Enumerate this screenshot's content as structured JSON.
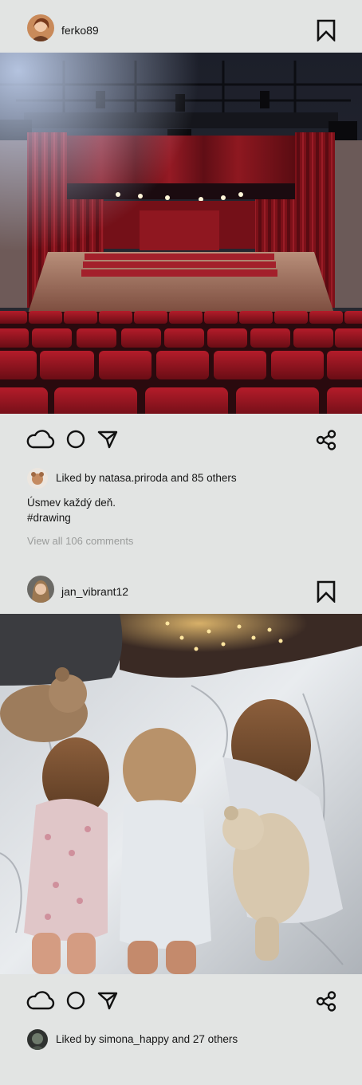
{
  "posts": [
    {
      "username": "ferko89",
      "photo_icon": "theater-auditorium-photo",
      "liked_by_text": "Liked by natasa.priroda and 85 others",
      "caption_line1": "Úsmev každý deň.",
      "caption_line2": "#drawing",
      "view_comments": "View all 106 comments"
    },
    {
      "username": "jan_vibrant12",
      "photo_icon": "girls-on-bed-photo",
      "liked_by_text": "Liked by simona_happy and 27 others"
    }
  ],
  "icons": {
    "like": "cloud-icon",
    "comment": "circle-icon",
    "send": "send-triangle-icon",
    "share": "share-icon",
    "bookmark": "bookmark-icon"
  }
}
